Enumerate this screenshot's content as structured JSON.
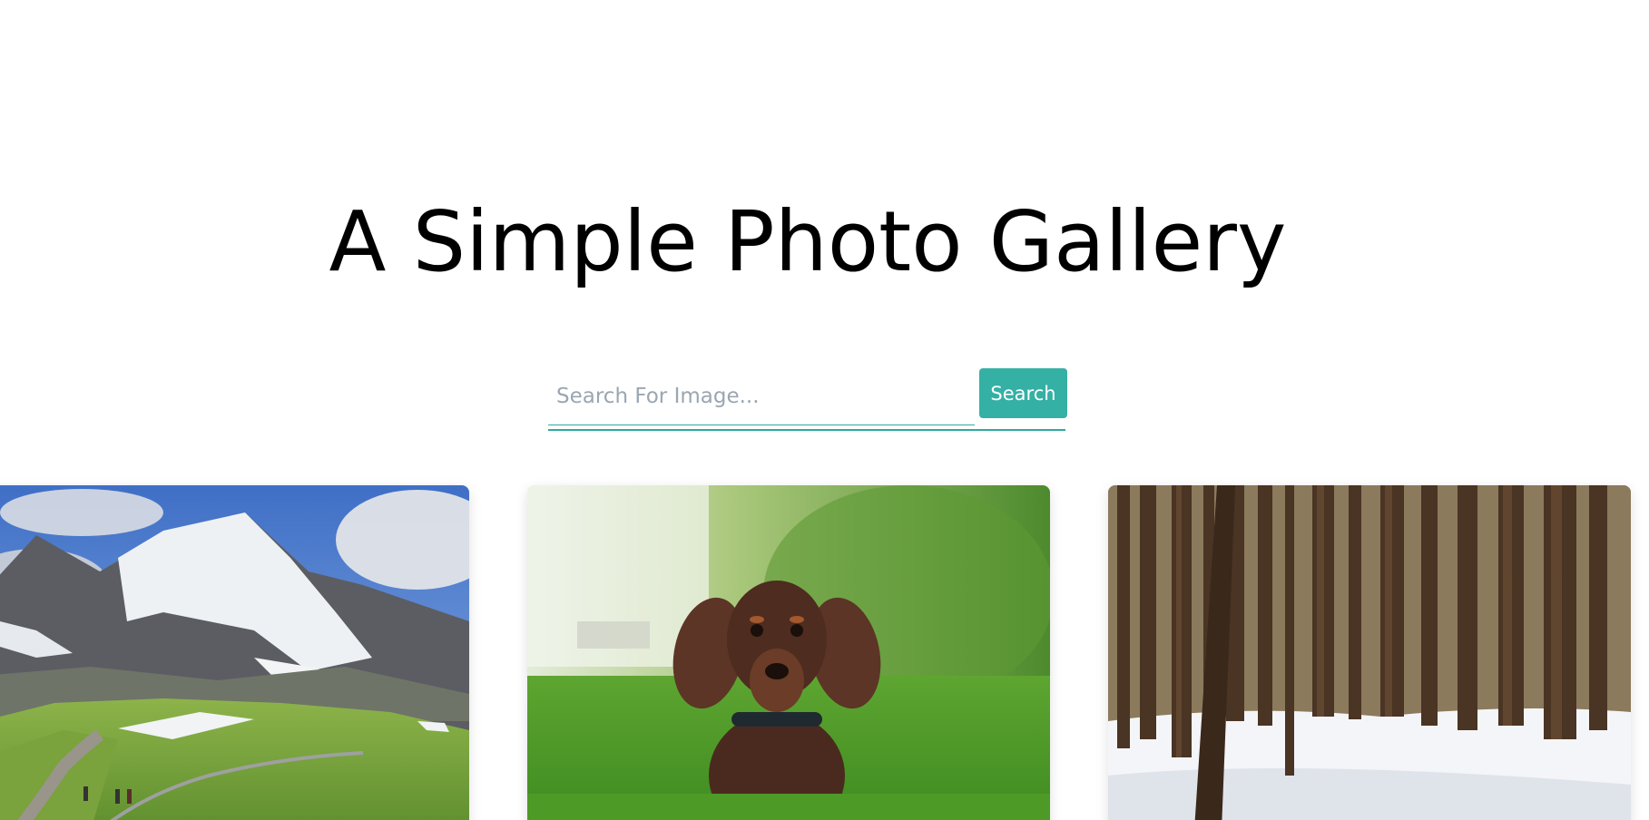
{
  "header": {
    "title": "A Simple Photo Gallery"
  },
  "search": {
    "placeholder": "Search For Image...",
    "value": "",
    "button_label": "Search"
  },
  "gallery": {
    "photos": [
      {
        "subject": "mountain landscape with hikers",
        "icon": "mountain-photo"
      },
      {
        "subject": "dachshund dog in grass",
        "icon": "dog-photo"
      },
      {
        "subject": "snowy pine forest",
        "icon": "forest-photo"
      }
    ]
  },
  "colors": {
    "accent": "#34b0a5",
    "underline": "#2fa9a0",
    "title": "#000000",
    "placeholder": "#9aa6b2"
  }
}
